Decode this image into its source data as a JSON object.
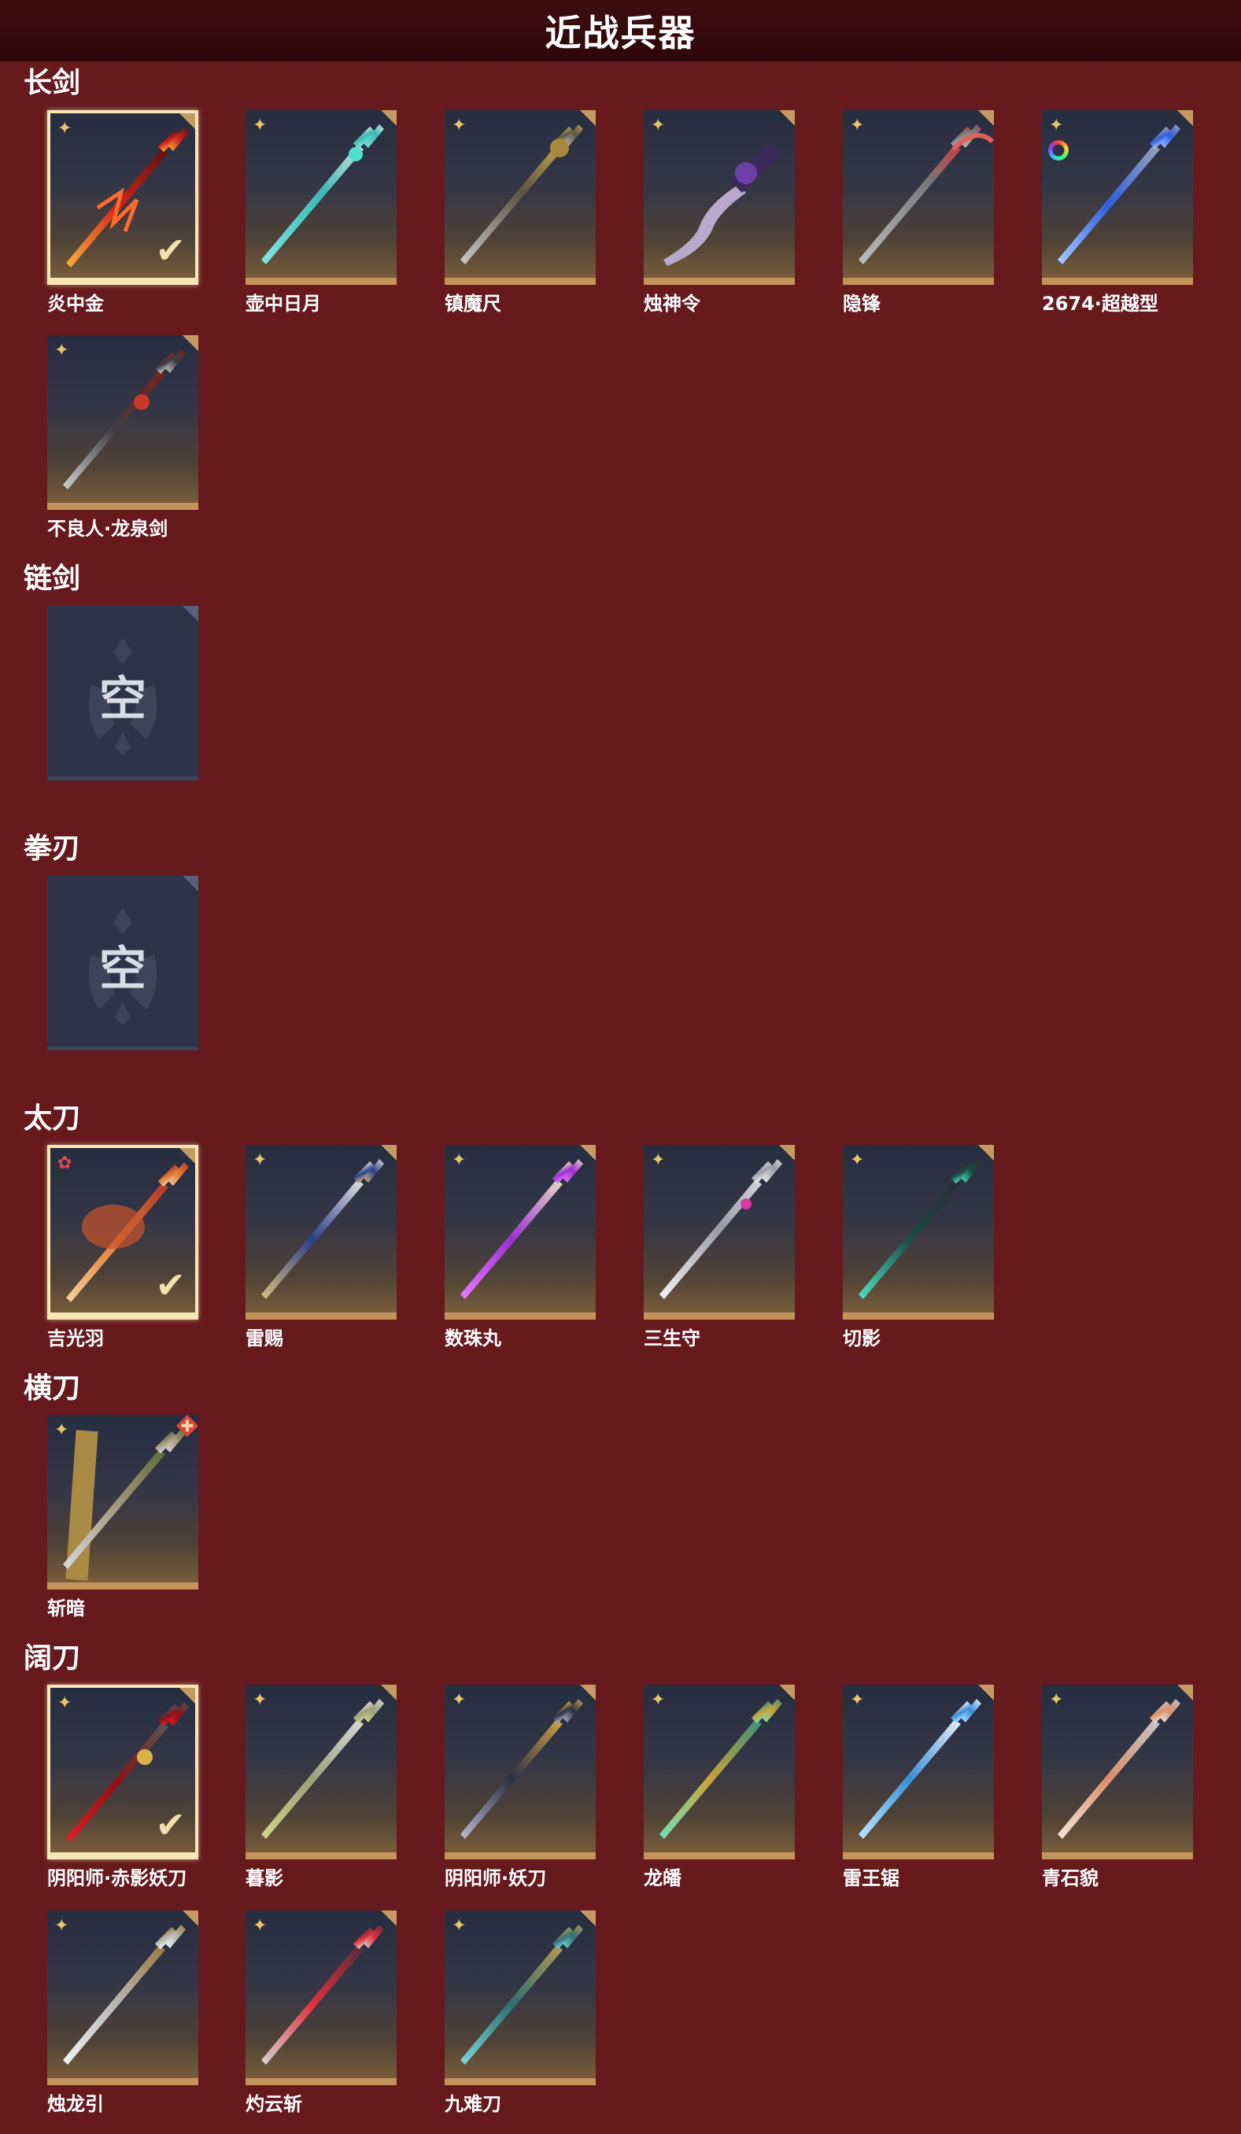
{
  "header": {
    "title": "近战兵器"
  },
  "colors": {
    "background": "#661a1e",
    "title_bar": "#3a0b0e",
    "card_border": "#c4935a",
    "selected_border": "#f6e7b4",
    "rarity_gold": "#e8c56a",
    "rarity_red": "#e24a52"
  },
  "sections": {
    "longsword": {
      "title": "长剑",
      "items": [
        {
          "name": "炎中金",
          "rarity_icon": "gold-shuriken-icon",
          "selected": true
        },
        {
          "name": "壶中日月",
          "rarity_icon": "gold-shuriken-icon"
        },
        {
          "name": "镇魔尺",
          "rarity_icon": "gold-shuriken-icon"
        },
        {
          "name": "烛神令",
          "rarity_icon": "gold-shuriken-icon"
        },
        {
          "name": "隐锋",
          "rarity_icon": "gold-shuriken-icon"
        },
        {
          "name": "2674·超越型",
          "rarity_icon": "gold-shuriken-icon",
          "extra_icon": "rainbow-ring-icon"
        },
        {
          "name": "不良人·龙泉剑",
          "rarity_icon": "gold-shuriken-icon"
        }
      ]
    },
    "chainsword": {
      "title": "链剑",
      "empty_text": "空"
    },
    "fistblade": {
      "title": "拳刃",
      "empty_text": "空"
    },
    "katana": {
      "title": "太刀",
      "items": [
        {
          "name": "吉光羽",
          "rarity_icon": "red-star-icon",
          "selected": true
        },
        {
          "name": "雷赐",
          "rarity_icon": "gold-shuriken-icon"
        },
        {
          "name": "数珠丸",
          "rarity_icon": "gold-shuriken-icon"
        },
        {
          "name": "三生守",
          "rarity_icon": "gold-shuriken-icon"
        },
        {
          "name": "切影",
          "rarity_icon": "gold-shuriken-icon"
        }
      ]
    },
    "sabre": {
      "title": "横刀",
      "items": [
        {
          "name": "斩暗",
          "rarity_icon": "gold-shuriken-icon",
          "extra_icon": "red-diamond-badge-icon"
        }
      ]
    },
    "greatblade": {
      "title": "阔刀",
      "items": [
        {
          "name": "阴阳师·赤影妖刀",
          "rarity_icon": "gold-shuriken-icon",
          "selected": true
        },
        {
          "name": "暮影",
          "rarity_icon": "gold-shuriken-icon"
        },
        {
          "name": "阴阳师·妖刀",
          "rarity_icon": "gold-shuriken-icon"
        },
        {
          "name": "龙皤",
          "rarity_icon": "gold-shuriken-icon"
        },
        {
          "name": "雷王锯",
          "rarity_icon": "gold-shuriken-icon"
        },
        {
          "name": "青石貌",
          "rarity_icon": "gold-shuriken-icon"
        },
        {
          "name": "烛龙引",
          "rarity_icon": "gold-shuriken-icon"
        },
        {
          "name": "灼云斩",
          "rarity_icon": "gold-shuriken-icon"
        },
        {
          "name": "九难刀",
          "rarity_icon": "gold-shuriken-icon"
        }
      ]
    }
  }
}
